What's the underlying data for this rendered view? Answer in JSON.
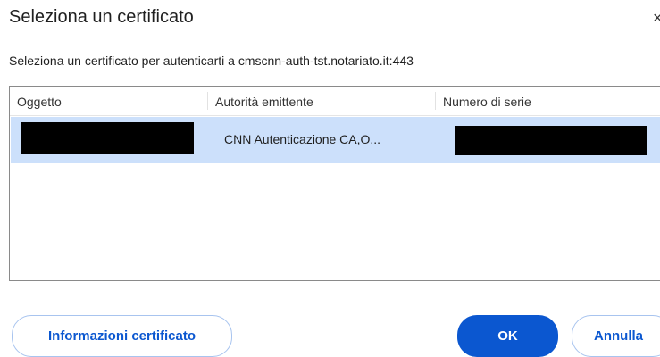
{
  "dialog": {
    "title": "Seleziona un certificato",
    "close_glyph": "×",
    "subtitle": "Seleziona un certificato per autenticarti a cmscnn-auth-tst.notariato.it:443"
  },
  "table": {
    "columns": [
      "Oggetto",
      "Autorità emittente",
      "Numero di serie"
    ],
    "rows": [
      {
        "subject": "",
        "issuer": "CNN Autenticazione CA,O...",
        "serial": "",
        "selected": true
      }
    ]
  },
  "buttons": {
    "info_label": "Informazioni certificato",
    "ok_label": "OK",
    "cancel_label": "Annulla"
  },
  "colors": {
    "accent": "#0b57d0",
    "selected_row": "#cce0fb",
    "outline_button_border": "#a8c4ef"
  }
}
